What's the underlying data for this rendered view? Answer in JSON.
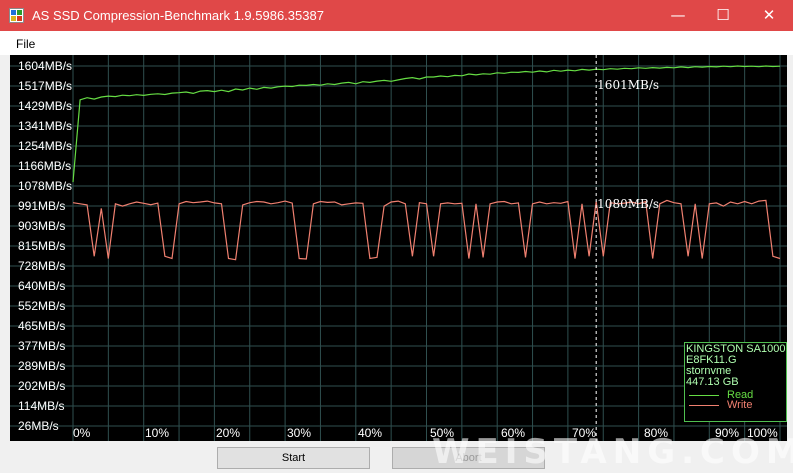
{
  "window": {
    "title": "AS SSD Compression-Benchmark 1.9.5986.35387",
    "minimize_glyph": "—",
    "maximize_glyph": "☐",
    "close_glyph": "✕"
  },
  "menu": {
    "file": "File"
  },
  "chart": {
    "y_labels": [
      "1604MB/s",
      "1517MB/s",
      "1429MB/s",
      "1341MB/s",
      "1254MB/s",
      "1166MB/s",
      "1078MB/s",
      "991MB/s",
      "903MB/s",
      "815MB/s",
      "728MB/s",
      "640MB/s",
      "552MB/s",
      "465MB/s",
      "377MB/s",
      "289MB/s",
      "202MB/s",
      "114MB/s",
      "26MB/s"
    ],
    "x_labels": [
      "0%",
      "10%",
      "20%",
      "30%",
      "40%",
      "50%",
      "60%",
      "70%",
      "80%",
      "90%",
      "100%"
    ],
    "read_marker": "1601MB/s",
    "write_marker": "1080MB/s"
  },
  "chart_data": {
    "type": "line",
    "xlabel": "",
    "ylabel": "",
    "x_unit": "%",
    "y_unit": "MB/s",
    "xlim": [
      0,
      100
    ],
    "ylim": [
      26,
      1604
    ],
    "grid": true,
    "legend_placement": "bottom-right",
    "marker_x": 74,
    "colors": {
      "read": "#66dd44",
      "write": "#f08070"
    },
    "series": [
      {
        "name": "Read",
        "x": [
          0,
          1,
          2,
          3,
          4,
          5,
          6,
          7,
          8,
          9,
          10,
          11,
          12,
          13,
          14,
          15,
          16,
          17,
          18,
          19,
          20,
          21,
          22,
          23,
          24,
          25,
          26,
          27,
          28,
          29,
          30,
          31,
          32,
          33,
          34,
          35,
          36,
          37,
          38,
          39,
          40,
          41,
          42,
          43,
          44,
          45,
          46,
          47,
          48,
          49,
          50,
          51,
          52,
          53,
          54,
          55,
          56,
          57,
          58,
          59,
          60,
          61,
          62,
          63,
          64,
          65,
          66,
          67,
          68,
          69,
          70,
          71,
          72,
          73,
          74,
          75,
          76,
          77,
          78,
          79,
          80,
          81,
          82,
          83,
          84,
          85,
          86,
          87,
          88,
          89,
          90,
          91,
          92,
          93,
          94,
          95,
          96,
          97,
          98,
          99,
          100
        ],
        "values": [
          1095,
          1456,
          1465,
          1459,
          1468,
          1472,
          1470,
          1476,
          1474,
          1478,
          1475,
          1480,
          1482,
          1479,
          1485,
          1487,
          1490,
          1484,
          1494,
          1496,
          1492,
          1498,
          1492,
          1503,
          1499,
          1507,
          1502,
          1510,
          1507,
          1513,
          1516,
          1514,
          1520,
          1519,
          1523,
          1520,
          1526,
          1523,
          1529,
          1532,
          1526,
          1535,
          1532,
          1538,
          1541,
          1537,
          1543,
          1549,
          1553,
          1547,
          1556,
          1556,
          1560,
          1557,
          1563,
          1561,
          1569,
          1565,
          1570,
          1568,
          1574,
          1572,
          1577,
          1576,
          1580,
          1577,
          1582,
          1578,
          1585,
          1581,
          1586,
          1583,
          1589,
          1586,
          1590,
          1588,
          1592,
          1590,
          1594,
          1592,
          1596,
          1594,
          1597,
          1595,
          1598,
          1596,
          1600,
          1597,
          1601,
          1599,
          1602,
          1600,
          1603,
          1601,
          1604,
          1602,
          1603,
          1601,
          1604,
          1602,
          1603
        ]
      },
      {
        "name": "Write",
        "x": [
          0,
          1,
          2,
          3,
          4,
          5,
          6,
          7,
          8,
          9,
          10,
          11,
          12,
          13,
          14,
          15,
          16,
          17,
          18,
          19,
          20,
          21,
          22,
          23,
          24,
          25,
          26,
          27,
          28,
          29,
          30,
          31,
          32,
          33,
          34,
          35,
          36,
          37,
          38,
          39,
          40,
          41,
          42,
          43,
          44,
          45,
          46,
          47,
          48,
          49,
          50,
          51,
          52,
          53,
          54,
          55,
          56,
          57,
          58,
          59,
          60,
          61,
          62,
          63,
          64,
          65,
          66,
          67,
          68,
          69,
          70,
          71,
          72,
          73,
          74,
          75,
          76,
          77,
          78,
          79,
          80,
          81,
          82,
          83,
          84,
          85,
          86,
          87,
          88,
          89,
          90,
          91,
          92,
          93,
          94,
          95,
          96,
          97,
          98,
          99,
          100
        ],
        "values": [
          1005,
          1000,
          995,
          770,
          980,
          760,
          1000,
          990,
          1000,
          1008,
          1002,
          996,
          1003,
          770,
          760,
          1000,
          1010,
          1005,
          1008,
          1012,
          1004,
          1000,
          760,
          755,
          995,
          1005,
          1010,
          1008,
          1000,
          1005,
          1012,
          1003,
          760,
          758,
          1000,
          1010,
          1006,
          1008,
          995,
          1000,
          1004,
          1002,
          760,
          765,
          990,
          1008,
          1012,
          1000,
          770,
          1005,
          1000,
          770,
          1000,
          1004,
          1000,
          1002,
          760,
          1000,
          765,
          1000,
          1008,
          1010,
          1000,
          1004,
          765,
          1000,
          1008,
          1000,
          1005,
          1002,
          1010,
          760,
          1000,
          770,
          1010,
          770,
          1005,
          1000,
          1003,
          1008,
          1000,
          1010,
          760,
          1000,
          1015,
          1005,
          1000,
          770,
          1000,
          760,
          1000,
          1004,
          990,
          1008,
          1000,
          1010,
          1000,
          1012,
          1015,
          770,
          760
        ]
      }
    ]
  },
  "legend": {
    "model": "KINGSTON SA1000",
    "firmware": "E8FK11.G",
    "driver": "stornvme",
    "capacity": "447.13 GB",
    "read_label": "Read",
    "write_label": "Write"
  },
  "buttons": {
    "start": "Start",
    "abort": "Abort"
  },
  "watermark": "WEISTANG.COM"
}
